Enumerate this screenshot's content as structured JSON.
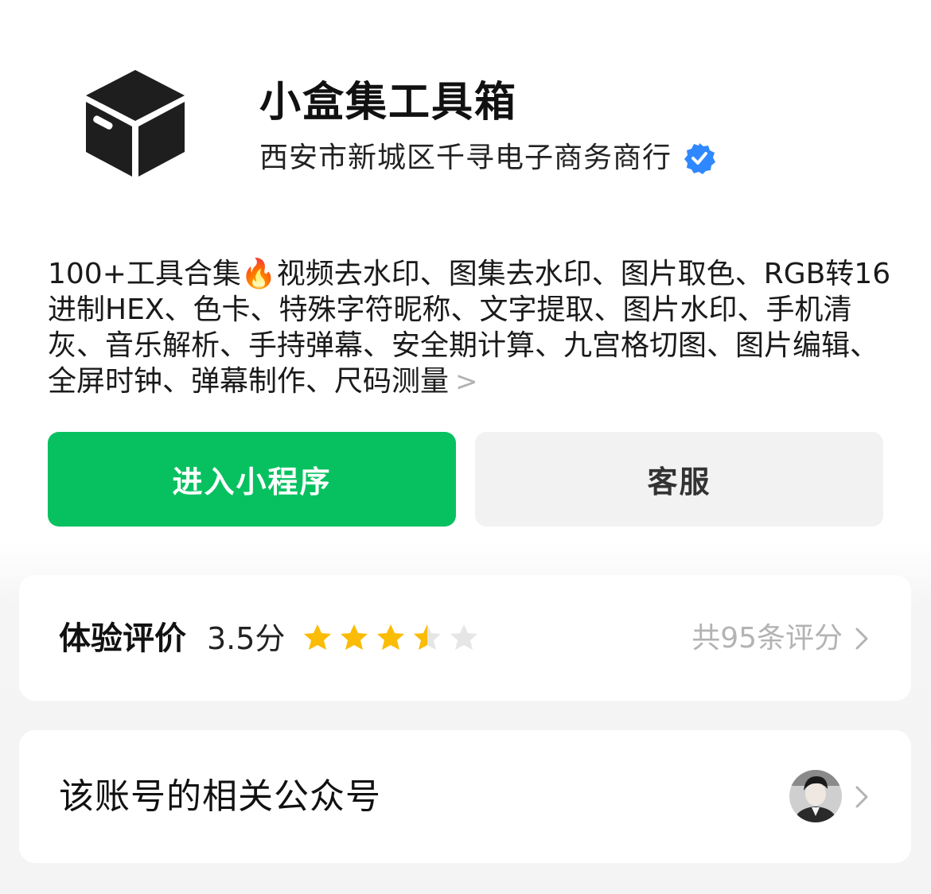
{
  "app": {
    "name": "小盒集工具箱",
    "company": "西安市新城区千寻电子商务商行",
    "logo_icon": "box-icon",
    "verified_icon": "verified-badge-icon",
    "description": "100+工具合集🔥视频去水印、图集去水印、图片取色、RGB转16进制HEX、色卡、特殊字符昵称、文字提取、图片水印、手机清灰、音乐解析、手持弹幕、安全期计算、九宫格切图、图片编辑、全屏时钟、弹幕制作、尺码测量",
    "description_more": ">"
  },
  "buttons": {
    "enter_label": "进入小程序",
    "service_label": "客服"
  },
  "rating": {
    "label": "体验评价",
    "score_text": "3.5分",
    "score": 3.5,
    "max": 5,
    "count_text": "共95条评分"
  },
  "related": {
    "label": "该账号的相关公众号",
    "avatar_icon": "avatar-icon"
  },
  "colors": {
    "primary": "#07c160",
    "star": "#fbbc05",
    "star_empty": "#e6e6e6",
    "verified": "#2f88ff"
  }
}
